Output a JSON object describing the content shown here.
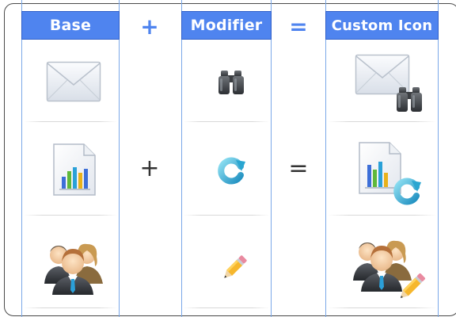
{
  "headers": {
    "base": "Base",
    "modifier": "Modifier",
    "result": "Custom Icon"
  },
  "operators": {
    "plus": "+",
    "equals": "="
  },
  "rows": [
    {
      "base_icon": "envelope-icon",
      "modifier_icon": "binoculars-icon",
      "result_icon": "envelope-binoculars-icon"
    },
    {
      "base_icon": "chart-document-icon",
      "modifier_icon": "refresh-icon",
      "result_icon": "chart-document-refresh-icon"
    },
    {
      "base_icon": "users-icon",
      "modifier_icon": "pencil-icon",
      "result_icon": "users-pencil-icon"
    }
  ],
  "colors": {
    "header_fill": "#4f84ef",
    "column_border": "#7aa8e8",
    "operator_top": "#4f84ef",
    "operator_mid": "#333333"
  }
}
